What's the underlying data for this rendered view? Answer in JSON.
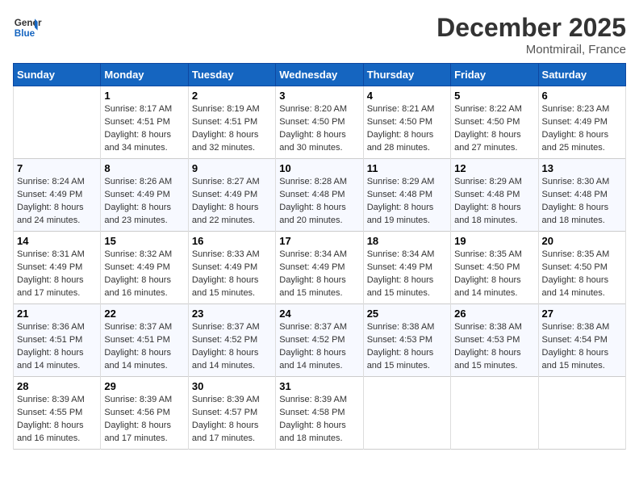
{
  "header": {
    "logo_line1": "General",
    "logo_line2": "Blue",
    "month": "December 2025",
    "location": "Montmirail, France"
  },
  "weekdays": [
    "Sunday",
    "Monday",
    "Tuesday",
    "Wednesday",
    "Thursday",
    "Friday",
    "Saturday"
  ],
  "weeks": [
    [
      {
        "day": "",
        "info": ""
      },
      {
        "day": "1",
        "info": "Sunrise: 8:17 AM\nSunset: 4:51 PM\nDaylight: 8 hours\nand 34 minutes."
      },
      {
        "day": "2",
        "info": "Sunrise: 8:19 AM\nSunset: 4:51 PM\nDaylight: 8 hours\nand 32 minutes."
      },
      {
        "day": "3",
        "info": "Sunrise: 8:20 AM\nSunset: 4:50 PM\nDaylight: 8 hours\nand 30 minutes."
      },
      {
        "day": "4",
        "info": "Sunrise: 8:21 AM\nSunset: 4:50 PM\nDaylight: 8 hours\nand 28 minutes."
      },
      {
        "day": "5",
        "info": "Sunrise: 8:22 AM\nSunset: 4:50 PM\nDaylight: 8 hours\nand 27 minutes."
      },
      {
        "day": "6",
        "info": "Sunrise: 8:23 AM\nSunset: 4:49 PM\nDaylight: 8 hours\nand 25 minutes."
      }
    ],
    [
      {
        "day": "7",
        "info": "Sunrise: 8:24 AM\nSunset: 4:49 PM\nDaylight: 8 hours\nand 24 minutes."
      },
      {
        "day": "8",
        "info": "Sunrise: 8:26 AM\nSunset: 4:49 PM\nDaylight: 8 hours\nand 23 minutes."
      },
      {
        "day": "9",
        "info": "Sunrise: 8:27 AM\nSunset: 4:49 PM\nDaylight: 8 hours\nand 22 minutes."
      },
      {
        "day": "10",
        "info": "Sunrise: 8:28 AM\nSunset: 4:48 PM\nDaylight: 8 hours\nand 20 minutes."
      },
      {
        "day": "11",
        "info": "Sunrise: 8:29 AM\nSunset: 4:48 PM\nDaylight: 8 hours\nand 19 minutes."
      },
      {
        "day": "12",
        "info": "Sunrise: 8:29 AM\nSunset: 4:48 PM\nDaylight: 8 hours\nand 18 minutes."
      },
      {
        "day": "13",
        "info": "Sunrise: 8:30 AM\nSunset: 4:48 PM\nDaylight: 8 hours\nand 18 minutes."
      }
    ],
    [
      {
        "day": "14",
        "info": "Sunrise: 8:31 AM\nSunset: 4:49 PM\nDaylight: 8 hours\nand 17 minutes."
      },
      {
        "day": "15",
        "info": "Sunrise: 8:32 AM\nSunset: 4:49 PM\nDaylight: 8 hours\nand 16 minutes."
      },
      {
        "day": "16",
        "info": "Sunrise: 8:33 AM\nSunset: 4:49 PM\nDaylight: 8 hours\nand 15 minutes."
      },
      {
        "day": "17",
        "info": "Sunrise: 8:34 AM\nSunset: 4:49 PM\nDaylight: 8 hours\nand 15 minutes."
      },
      {
        "day": "18",
        "info": "Sunrise: 8:34 AM\nSunset: 4:49 PM\nDaylight: 8 hours\nand 15 minutes."
      },
      {
        "day": "19",
        "info": "Sunrise: 8:35 AM\nSunset: 4:50 PM\nDaylight: 8 hours\nand 14 minutes."
      },
      {
        "day": "20",
        "info": "Sunrise: 8:35 AM\nSunset: 4:50 PM\nDaylight: 8 hours\nand 14 minutes."
      }
    ],
    [
      {
        "day": "21",
        "info": "Sunrise: 8:36 AM\nSunset: 4:51 PM\nDaylight: 8 hours\nand 14 minutes."
      },
      {
        "day": "22",
        "info": "Sunrise: 8:37 AM\nSunset: 4:51 PM\nDaylight: 8 hours\nand 14 minutes."
      },
      {
        "day": "23",
        "info": "Sunrise: 8:37 AM\nSunset: 4:52 PM\nDaylight: 8 hours\nand 14 minutes."
      },
      {
        "day": "24",
        "info": "Sunrise: 8:37 AM\nSunset: 4:52 PM\nDaylight: 8 hours\nand 14 minutes."
      },
      {
        "day": "25",
        "info": "Sunrise: 8:38 AM\nSunset: 4:53 PM\nDaylight: 8 hours\nand 15 minutes."
      },
      {
        "day": "26",
        "info": "Sunrise: 8:38 AM\nSunset: 4:53 PM\nDaylight: 8 hours\nand 15 minutes."
      },
      {
        "day": "27",
        "info": "Sunrise: 8:38 AM\nSunset: 4:54 PM\nDaylight: 8 hours\nand 15 minutes."
      }
    ],
    [
      {
        "day": "28",
        "info": "Sunrise: 8:39 AM\nSunset: 4:55 PM\nDaylight: 8 hours\nand 16 minutes."
      },
      {
        "day": "29",
        "info": "Sunrise: 8:39 AM\nSunset: 4:56 PM\nDaylight: 8 hours\nand 17 minutes."
      },
      {
        "day": "30",
        "info": "Sunrise: 8:39 AM\nSunset: 4:57 PM\nDaylight: 8 hours\nand 17 minutes."
      },
      {
        "day": "31",
        "info": "Sunrise: 8:39 AM\nSunset: 4:58 PM\nDaylight: 8 hours\nand 18 minutes."
      },
      {
        "day": "",
        "info": ""
      },
      {
        "day": "",
        "info": ""
      },
      {
        "day": "",
        "info": ""
      }
    ]
  ]
}
